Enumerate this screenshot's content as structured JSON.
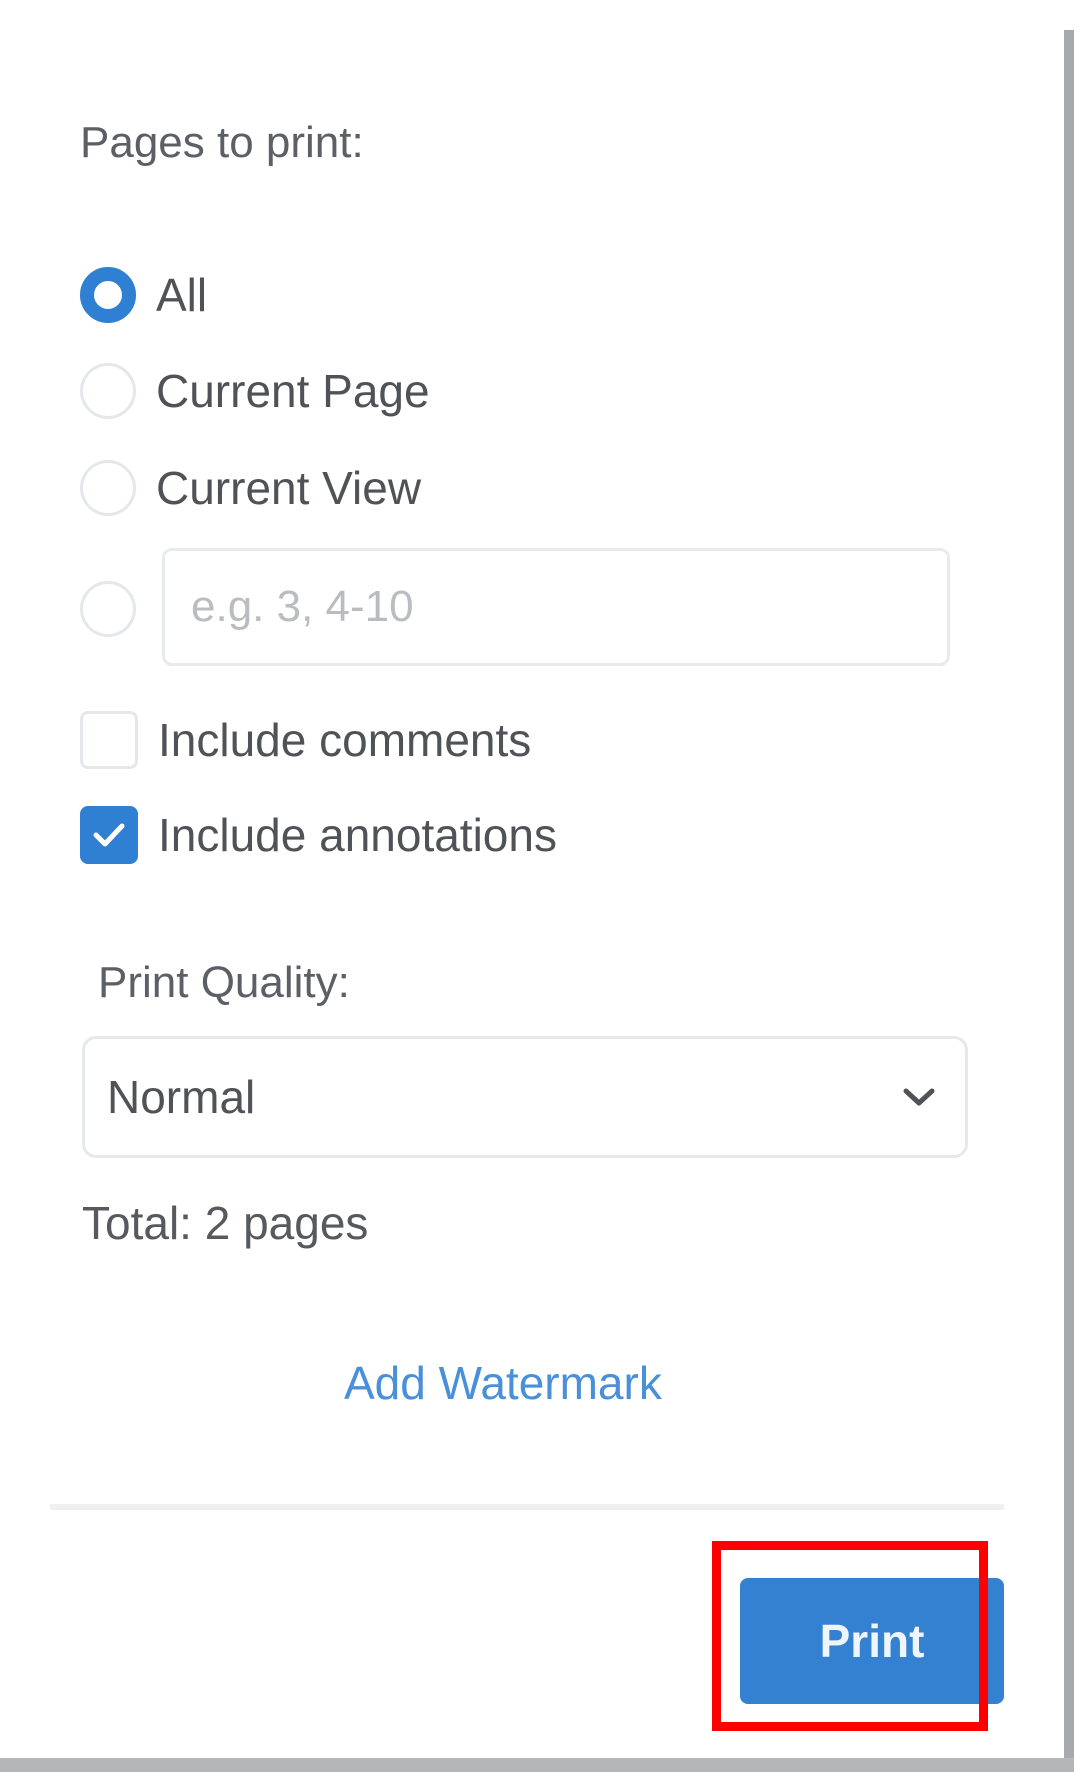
{
  "dialog": {
    "pages_label": "Pages to print:",
    "options": [
      {
        "label": "All",
        "checked": true
      },
      {
        "label": "Current Page",
        "checked": false
      },
      {
        "label": "Current View",
        "checked": false
      },
      {
        "label": "",
        "checked": false
      }
    ],
    "range_placeholder": "e.g. 3, 4-10",
    "range_value": "",
    "include_comments": {
      "label": "Include comments",
      "checked": false
    },
    "include_annotations": {
      "label": "Include annotations",
      "checked": true
    },
    "quality_label": "Print Quality:",
    "quality_selected": "Normal",
    "total_text": "Total: 2 pages",
    "watermark_link": "Add Watermark",
    "print_button": "Print"
  },
  "colors": {
    "accent": "#2f7fd3",
    "link": "#4a90d9",
    "highlight": "#ff0000"
  }
}
